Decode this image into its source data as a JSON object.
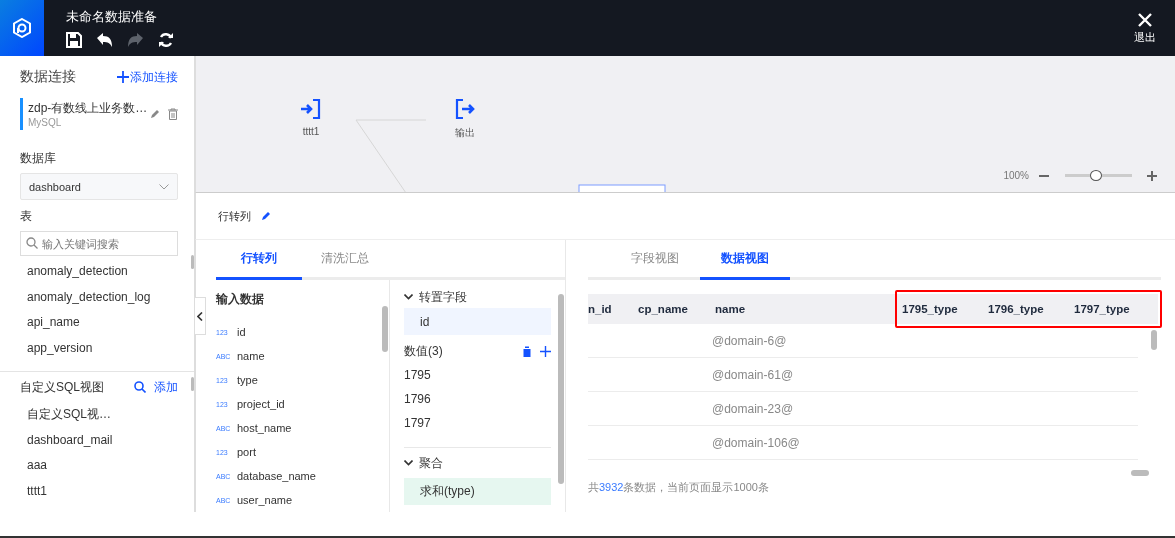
{
  "app": {
    "title": "未命名数据准备",
    "exit_label": "退出"
  },
  "toolbar": [
    {
      "kind": "save",
      "disabled": false
    },
    {
      "kind": "undo",
      "disabled": false
    },
    {
      "kind": "redo",
      "disabled": true
    },
    {
      "kind": "refresh",
      "disabled": false
    }
  ],
  "sidebar": {
    "connections_heading": "数据连接",
    "add_connection": "添加连接",
    "connections": [
      {
        "name": "zdp-有数线上业务数…",
        "type": "MySQL",
        "selected": true
      }
    ],
    "database_label": "数据库",
    "database": "dashboard",
    "table_label": "表",
    "table_search": {
      "placeholder": "输入关键词搜索"
    },
    "tables": [
      "anomaly_detection",
      "anomaly_detection_log",
      "api_name",
      "app_version"
    ],
    "sql_heading": "自定义SQL视图",
    "sql_add": "添加",
    "sql_views": [
      "自定义SQL视…",
      "dashboard_mail",
      "aaa",
      "tttt1"
    ]
  },
  "canvas": {
    "nodes": [
      {
        "kind": "input",
        "label": "tttt1"
      },
      {
        "kind": "output",
        "label": "输出"
      }
    ],
    "zoom_reading": "100%",
    "zoom": {
      "level": 0.49
    }
  },
  "panel": {
    "title": "行转列",
    "tabs": [
      {
        "label": "行转列",
        "selected": true
      },
      {
        "label": "清洗汇总",
        "selected": false
      }
    ],
    "input_heading": "输入数据",
    "fields": [
      {
        "type": "123",
        "name": "id"
      },
      {
        "type": "ABC",
        "name": "name"
      },
      {
        "type": "123",
        "name": "type"
      },
      {
        "type": "123",
        "name": "project_id"
      },
      {
        "type": "ABC",
        "name": "host_name"
      },
      {
        "type": "123",
        "name": "port"
      },
      {
        "type": "ABC",
        "name": "database_name"
      },
      {
        "type": "ABC",
        "name": "user_name"
      }
    ],
    "pivot": {
      "heading": "转置字段",
      "expanded": true,
      "field": "id"
    },
    "values": {
      "heading": "数值(3)",
      "items": [
        "1795",
        "1796",
        "1797"
      ]
    },
    "aggregate": {
      "heading": "聚合",
      "expanded": true,
      "item": "求和(type)"
    }
  },
  "data_view": {
    "tabs": [
      {
        "label": "字段视图",
        "selected": false
      },
      {
        "label": "数据视图",
        "selected": true
      }
    ],
    "columns": [
      {
        "label": "n_id",
        "highlighted": false
      },
      {
        "label": "cp_name",
        "highlighted": false
      },
      {
        "label": "name",
        "highlighted": false
      },
      {
        "label": "1795_type",
        "highlighted": true
      },
      {
        "label": "1796_type",
        "highlighted": true
      },
      {
        "label": "1797_type",
        "highlighted": true
      }
    ],
    "rows": [
      {
        "name": "@domain-6@"
      },
      {
        "name": "@domain-61@"
      },
      {
        "name": "@domain-23@"
      },
      {
        "name": "@domain-106@"
      }
    ],
    "footer": {
      "prefix": "共",
      "count": "3932",
      "suffix": "条数据，当前页面显示1000条"
    }
  }
}
